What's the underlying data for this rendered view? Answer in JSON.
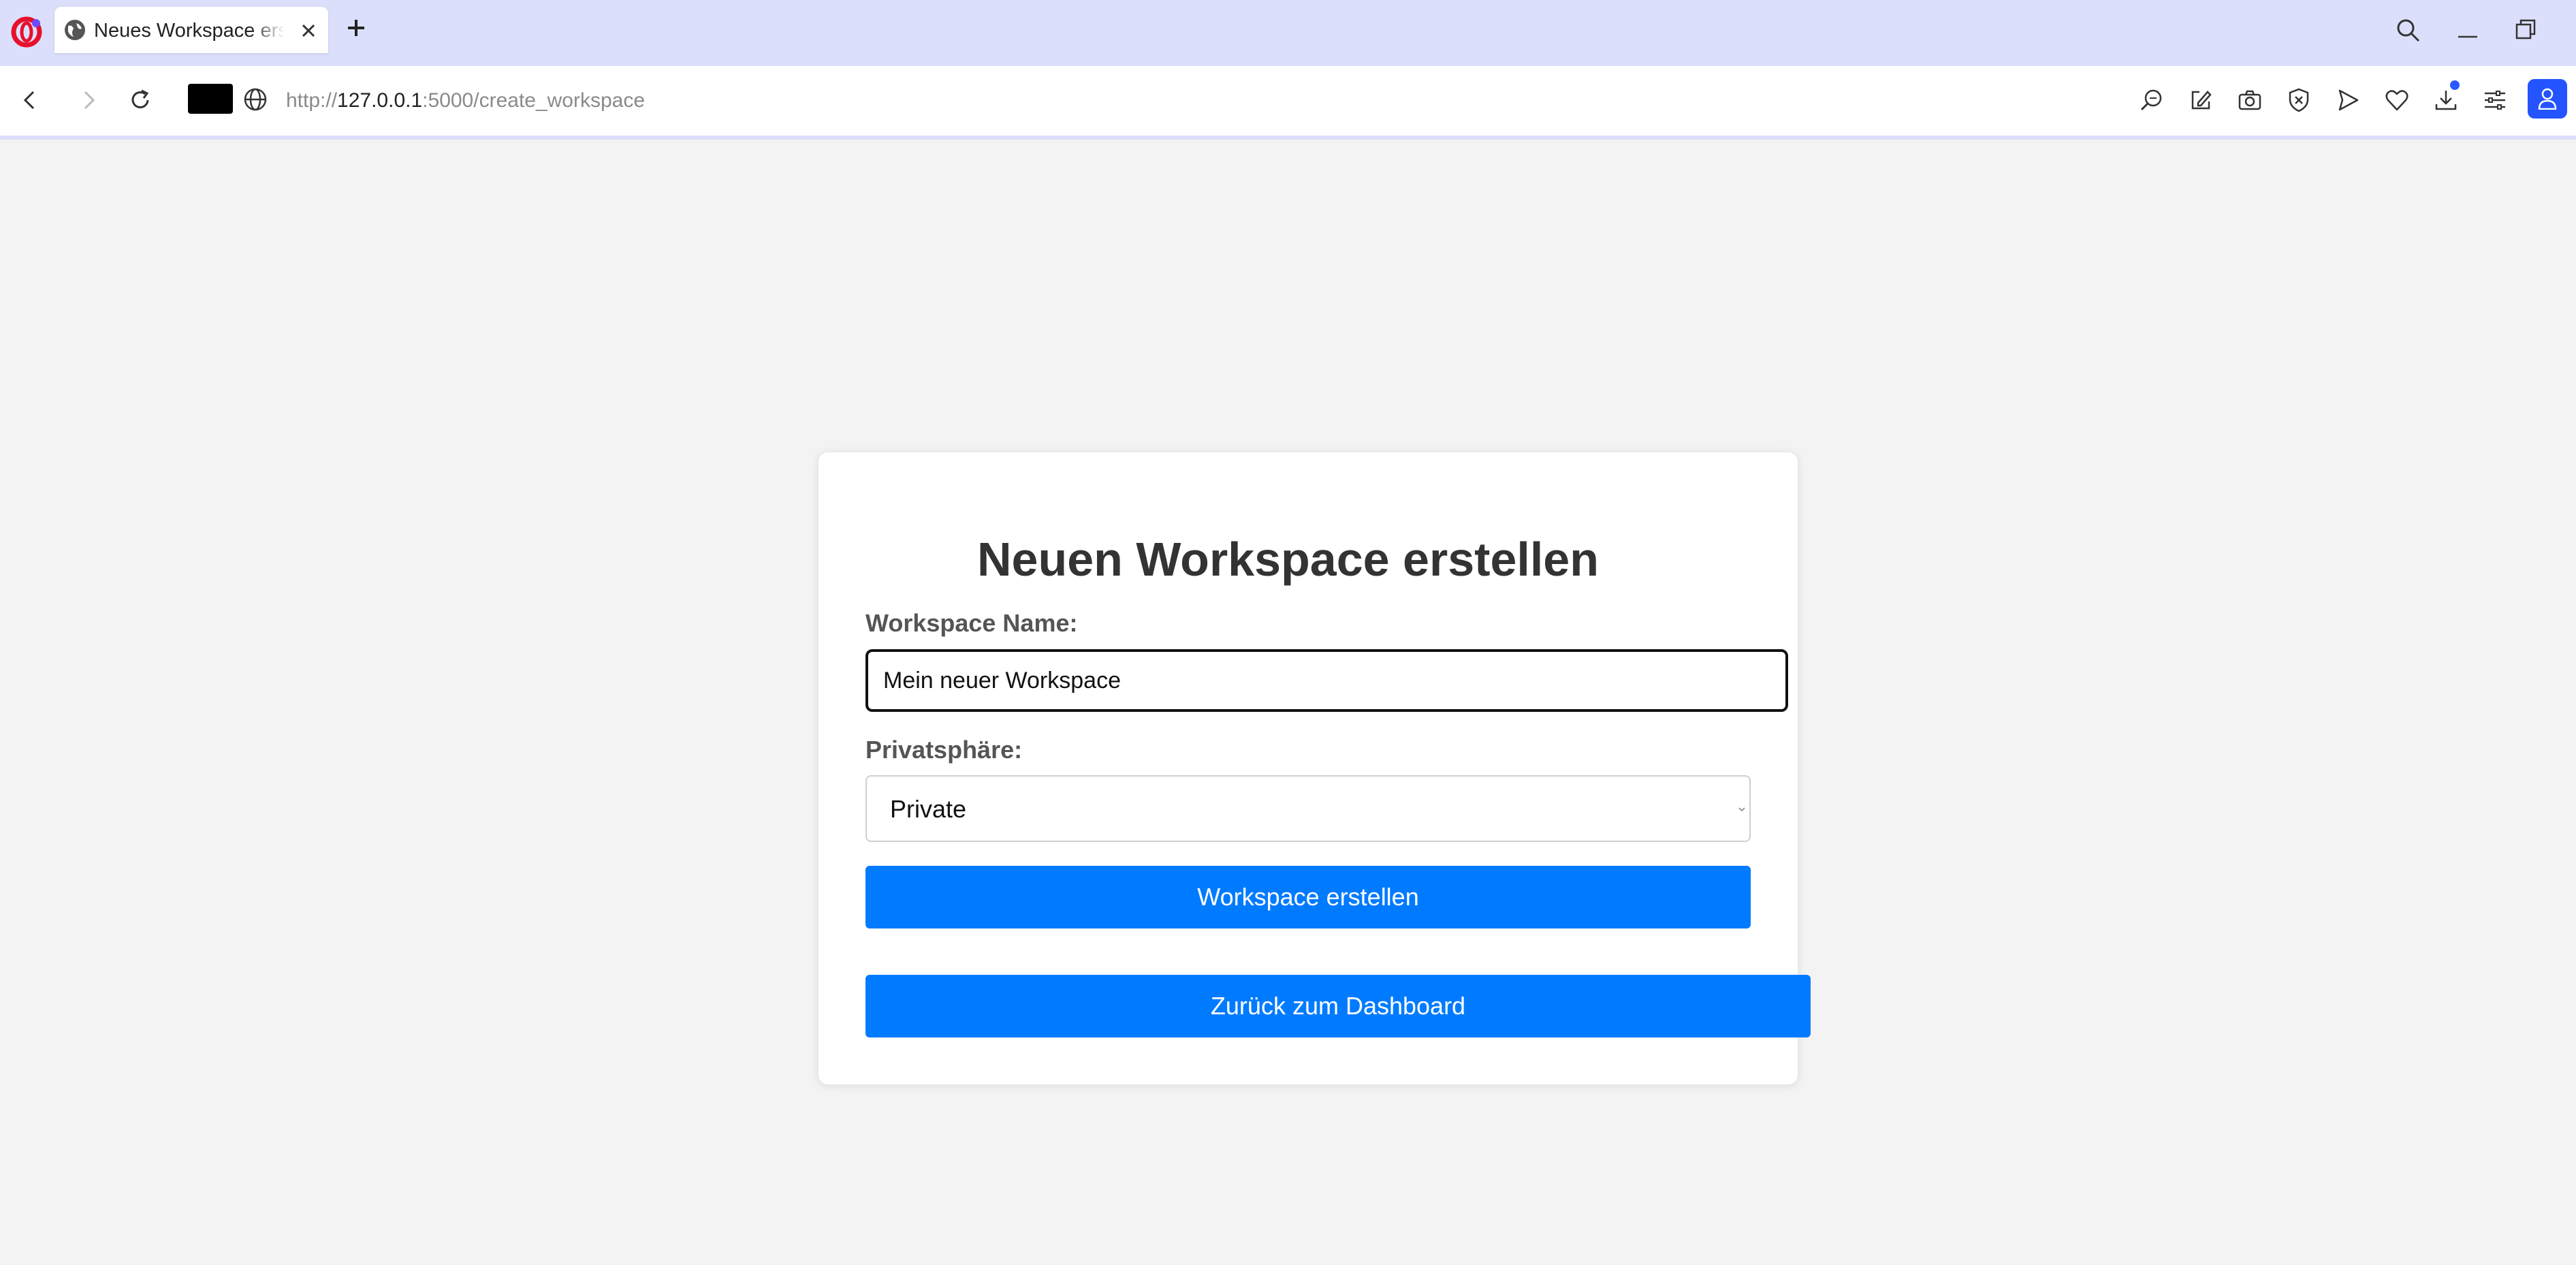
{
  "browser": {
    "tab": {
      "title": "Neues Workspace erstellen"
    },
    "address_bar": {
      "url_scheme": "http://",
      "url_host": "127.0.0.1",
      "url_path": ":5000/create_workspace"
    },
    "toolbar_icons": [
      "search-pages-icon",
      "snapshot-edit-icon",
      "camera-icon",
      "adblock-shield-icon",
      "send-flow-icon",
      "heart-icon",
      "download-icon",
      "settings-sliders-icon",
      "profile-icon"
    ],
    "accent_color": "#2454ff"
  },
  "page": {
    "title": "Neuen Workspace erstellen",
    "name_label": "Workspace Name:",
    "name_value": "Mein neuer Workspace",
    "privacy_label": "Privatsphäre:",
    "privacy_selected": "Private",
    "create_button": "Workspace erstellen",
    "back_button": "Zurück zum Dashboard",
    "button_color": "#007bff"
  }
}
